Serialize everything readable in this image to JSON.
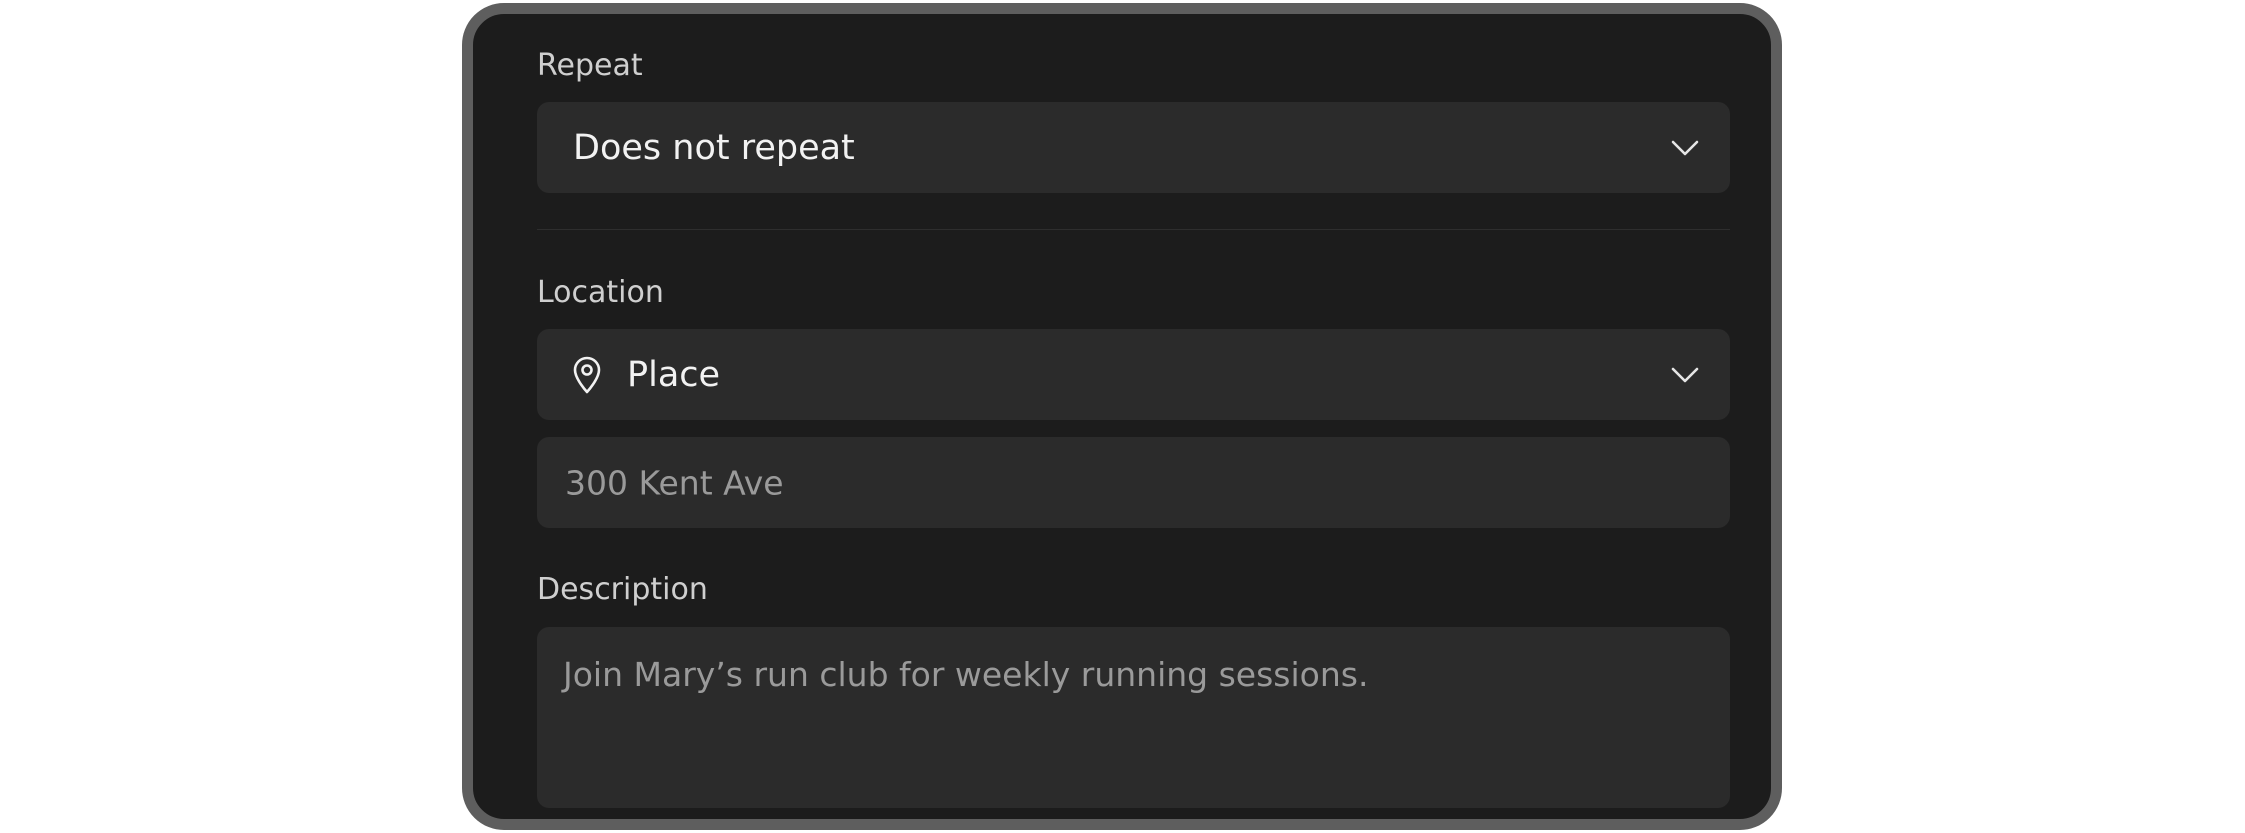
{
  "repeat": {
    "label": "Repeat",
    "selected": "Does not repeat",
    "chevron_icon": "chevron-down-icon"
  },
  "location": {
    "label": "Location",
    "type_selected": "Place",
    "type_icon": "location-pin-icon",
    "chevron_icon": "chevron-down-icon",
    "address_value": "300 Kent Ave"
  },
  "description": {
    "label": "Description",
    "value": "Join Mary’s run club for weekly running sessions."
  },
  "colors": {
    "panel_bg": "#1c1c1c",
    "field_bg": "#2b2b2b",
    "frame": "#5e5e5e",
    "label_text": "#cfcfcf",
    "value_text": "#f2f2f2",
    "placeholder_text": "#9a9a9a"
  }
}
